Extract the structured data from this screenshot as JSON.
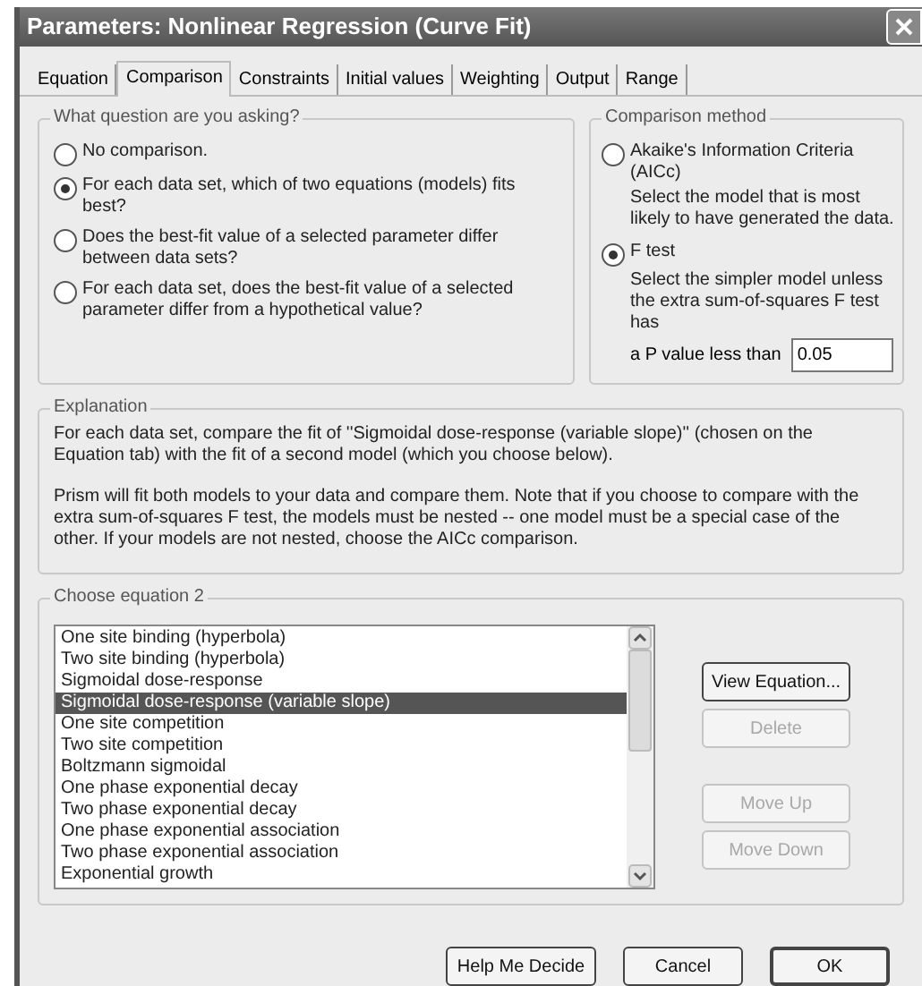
{
  "window": {
    "title": "Parameters: Nonlinear Regression (Curve Fit)"
  },
  "tabs": [
    {
      "label": "Equation",
      "selected": false
    },
    {
      "label": "Comparison",
      "selected": true
    },
    {
      "label": "Constraints",
      "selected": false
    },
    {
      "label": "Initial values",
      "selected": false
    },
    {
      "label": "Weighting",
      "selected": false
    },
    {
      "label": "Output",
      "selected": false
    },
    {
      "label": "Range",
      "selected": false
    }
  ],
  "question_group": {
    "title": "What question are you asking?",
    "options": [
      {
        "label": "No comparison.",
        "selected": false
      },
      {
        "label": "For each data set, which of two equations (models) fits best?",
        "selected": true
      },
      {
        "label": "Does the best-fit value of a selected parameter differ between data sets?",
        "selected": false
      },
      {
        "label": "For each data set, does the best-fit value of a selected parameter differ from a hypothetical value?",
        "selected": false
      }
    ]
  },
  "method_group": {
    "title": "Comparison method",
    "options": [
      {
        "label": "Akaike's Information Criteria (AICc)",
        "description": "Select the model that is most likely to have generated the data.",
        "selected": false
      },
      {
        "label": "F test",
        "description": "Select the simpler model unless the extra sum-of-squares F test has",
        "selected": true
      }
    ],
    "p_value": {
      "label": "a P value less than",
      "value": "0.05"
    }
  },
  "explanation": {
    "title": "Explanation",
    "paragraphs": [
      "For each data set, compare the fit of ''Sigmoidal dose-response (variable slope)'' (chosen on the Equation tab) with the fit of a second model (which you choose below).",
      "Prism will fit both models to your data and compare them. Note that if you choose to compare with the extra sum-of-squares F test, the models must be nested -- one model must be a special case of the other. If your models are not nested, choose the AICc comparison."
    ]
  },
  "equation_group": {
    "title": "Choose equation 2",
    "items": [
      {
        "label": "One site binding (hyperbola)",
        "selected": false
      },
      {
        "label": "Two site binding (hyperbola)",
        "selected": false
      },
      {
        "label": "Sigmoidal dose-response",
        "selected": false
      },
      {
        "label": "Sigmoidal dose-response (variable slope)",
        "selected": true
      },
      {
        "label": "One site competition",
        "selected": false
      },
      {
        "label": "Two site competition",
        "selected": false
      },
      {
        "label": "Boltzmann sigmoidal",
        "selected": false
      },
      {
        "label": "One phase exponential decay",
        "selected": false
      },
      {
        "label": "Two phase exponential decay",
        "selected": false
      },
      {
        "label": "One phase exponential association",
        "selected": false
      },
      {
        "label": "Two phase exponential association",
        "selected": false
      },
      {
        "label": "Exponential growth",
        "selected": false
      }
    ],
    "buttons": [
      {
        "label": "View Equation...",
        "disabled": false
      },
      {
        "label": "Delete",
        "disabled": true
      },
      {
        "label": "Move Up",
        "disabled": true
      },
      {
        "label": "Move Down",
        "disabled": true
      }
    ]
  },
  "footer_buttons": [
    {
      "label": "Help Me Decide",
      "default": false
    },
    {
      "label": "Cancel",
      "default": false
    },
    {
      "label": "OK",
      "default": true
    }
  ]
}
